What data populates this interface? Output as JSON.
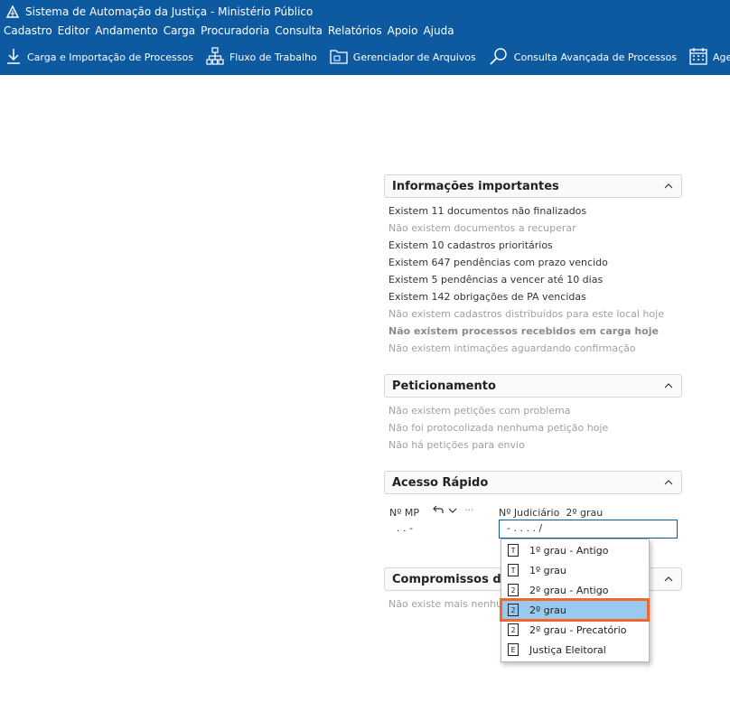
{
  "window": {
    "title": "Sistema de Automação da Justiça - Ministério Público"
  },
  "menu": [
    "Cadastro",
    "Editor",
    "Andamento",
    "Carga",
    "Procuradoria",
    "Consulta",
    "Relatórios",
    "Apoio",
    "Ajuda"
  ],
  "toolbar": [
    {
      "label": "Carga e Importação de Processos",
      "icon": "download-arrow-icon"
    },
    {
      "label": "Fluxo de Trabalho",
      "icon": "workflow-icon"
    },
    {
      "label": "Gerenciador de Arquivos",
      "icon": "folder-icon"
    },
    {
      "label": "Consulta Avançada de Processos",
      "icon": "search-icon"
    },
    {
      "label": "Agenda de Co",
      "icon": "calendar-icon"
    }
  ],
  "info": {
    "title": "Informações importantes",
    "lines": [
      "Existem 11 documentos não finalizados",
      "Não existem documentos a recuperar",
      "Existem 10 cadastros prioritários",
      "Existem 647 pendências com prazo vencido",
      "Existem 5 pendências a vencer até 10 dias",
      "Existem 142 obrigações de PA vencidas",
      "Não existem cadastros distribuídos para este local hoje",
      "Não existem processos recebidos em carga hoje",
      "Não existem intimações aguardando confirmação"
    ]
  },
  "peticionamento": {
    "title": "Peticionamento",
    "lines": [
      "Não existem petições com problema",
      "Não foi protocolizada nenhuma petição hoje",
      "Não há petições para envio"
    ]
  },
  "acesso": {
    "title": "Acesso Rápido",
    "label_mp": "Nº MP",
    "label_judiciario": "Nº Judiciário",
    "grau": "2º grau",
    "mp_value": " .  .      -",
    "jud_value": "   -  .    .  .  .    /",
    "more": "···"
  },
  "compromissos": {
    "title": "Compromissos do d",
    "line": "Não existe mais nenhum"
  },
  "dropdown": {
    "items": [
      {
        "label": "1º grau - Antigo",
        "icon": "T"
      },
      {
        "label": "1º grau",
        "icon": "T"
      },
      {
        "label": "2º grau - Antigo",
        "icon": "2"
      },
      {
        "label": "2º grau",
        "icon": "2"
      },
      {
        "label": "2º grau - Precatório",
        "icon": "2"
      },
      {
        "label": "Justiça Eleitoral",
        "icon": "E"
      }
    ],
    "selected_index": 3
  },
  "colors": {
    "brand": "#0d5aa0",
    "highlight": "#f0682a",
    "selected": "#99c9ef"
  }
}
